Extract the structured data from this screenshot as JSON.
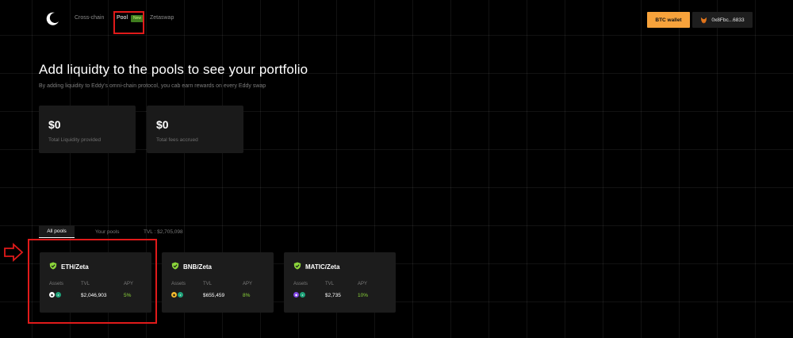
{
  "header": {
    "nav": [
      {
        "label": "Cross-chain"
      },
      {
        "label": "Pool",
        "badge": "New"
      },
      {
        "label": "Zetaswap"
      }
    ],
    "btc_wallet_label": "BTC wallet",
    "address_label": "0x8Fbc...6833"
  },
  "hero": {
    "title": "Add liquidty to the pools to see your portfolio",
    "subtitle": "By adding liquidity to Eddy's omni-chain protocol, you cab earn rewards on every Eddy swap"
  },
  "stats": [
    {
      "value": "$0",
      "label": "Total Liquidity provided"
    },
    {
      "value": "$0",
      "label": "Total fees accrued"
    }
  ],
  "tabs": {
    "all_pools": "All pools",
    "your_pools": "Your pools",
    "tvl": "TVL : $2,705,098"
  },
  "pools": [
    {
      "name": "ETH/Zeta",
      "assets_label": "Assets",
      "tvl_label": "TVL",
      "apy_label": "APY",
      "tvl": "$2,046,903",
      "apy": "5%",
      "asset_color": "#ffffff"
    },
    {
      "name": "BNB/Zeta",
      "assets_label": "Assets",
      "tvl_label": "TVL",
      "apy_label": "APY",
      "tvl": "$655,459",
      "apy": "8%",
      "asset_color": "#f3ba2f"
    },
    {
      "name": "MATIC/Zeta",
      "assets_label": "Assets",
      "tvl_label": "TVL",
      "apy_label": "APY",
      "tvl": "$2,735",
      "apy": "10%",
      "asset_color": "#8247e5"
    }
  ],
  "colors": {
    "accent_orange": "#f7a23b",
    "apy_green": "#8bd53a",
    "zeta_green": "#1fa37a",
    "highlight_red": "#e01a1a"
  }
}
